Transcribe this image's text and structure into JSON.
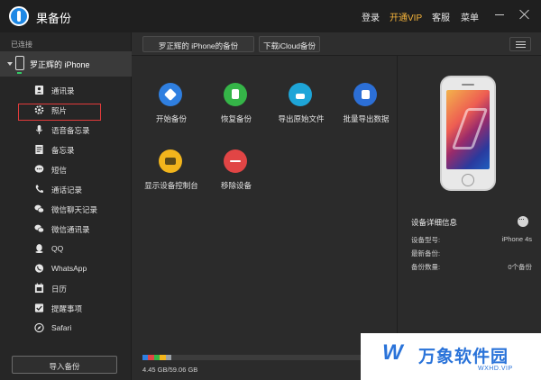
{
  "titlebar": {
    "app_title": "果备份",
    "links": {
      "login": "登录",
      "vip": "开通VIP",
      "service": "客服",
      "menu": "菜单"
    },
    "icons": [
      "logo-icon",
      "minimize-icon",
      "close-icon"
    ]
  },
  "sidebar": {
    "connected_label": "已连接",
    "device_name": "罗正辉的 iPhone",
    "items": [
      {
        "label": "通讯录",
        "icon": "contacts-icon"
      },
      {
        "label": "照片",
        "icon": "photos-gear-icon"
      },
      {
        "label": "语音备忘录",
        "icon": "microphone-icon"
      },
      {
        "label": "备忘录",
        "icon": "notes-icon"
      },
      {
        "label": "短信",
        "icon": "message-icon"
      },
      {
        "label": "通话记录",
        "icon": "phone-call-icon"
      },
      {
        "label": "微信聊天记录",
        "icon": "wechat-icon"
      },
      {
        "label": "微信通讯录",
        "icon": "wechat-contacts-icon"
      },
      {
        "label": "QQ",
        "icon": "qq-icon"
      },
      {
        "label": "WhatsApp",
        "icon": "whatsapp-icon"
      },
      {
        "label": "日历",
        "icon": "calendar-icon"
      },
      {
        "label": "提醒事项",
        "icon": "reminder-icon"
      },
      {
        "label": "Safari",
        "icon": "safari-icon"
      }
    ],
    "import_button": "导入备份"
  },
  "main": {
    "tabs": [
      {
        "label": "罗正辉的 iPhone的备份"
      },
      {
        "label": "下载iCloud备份"
      }
    ],
    "actions": [
      {
        "label": "开始备份",
        "color": "#2f7fe0",
        "icon": "backup-icon"
      },
      {
        "label": "恢复备份",
        "color": "#35b548",
        "icon": "restore-icon"
      },
      {
        "label": "导出原始文件",
        "color": "#1ea5d8",
        "icon": "export-icon"
      },
      {
        "label": "批量导出数据",
        "color": "#2c6fd6",
        "icon": "batch-export-icon"
      },
      {
        "label": "显示设备控制台",
        "color": "#f2b51c",
        "icon": "console-icon"
      },
      {
        "label": "移除设备",
        "color": "#e14545",
        "icon": "remove-icon"
      }
    ],
    "device_info": {
      "title": "设备详细信息",
      "rows": [
        {
          "label": "设备型号:",
          "value": "iPhone 4s"
        },
        {
          "label": "最新备份:",
          "value": ""
        },
        {
          "label": "备份数量:",
          "value": "0个备份"
        }
      ]
    },
    "storage": {
      "text": "4.45 GB/59.06 GB",
      "used_fraction": 0.075,
      "segment_colors": [
        "#2f7fe0",
        "#e14545",
        "#35b548",
        "#f2b51c",
        "#9aa0a6"
      ]
    }
  },
  "watermark": {
    "text": "万象软件园",
    "sub": "WXHD.VIP"
  }
}
